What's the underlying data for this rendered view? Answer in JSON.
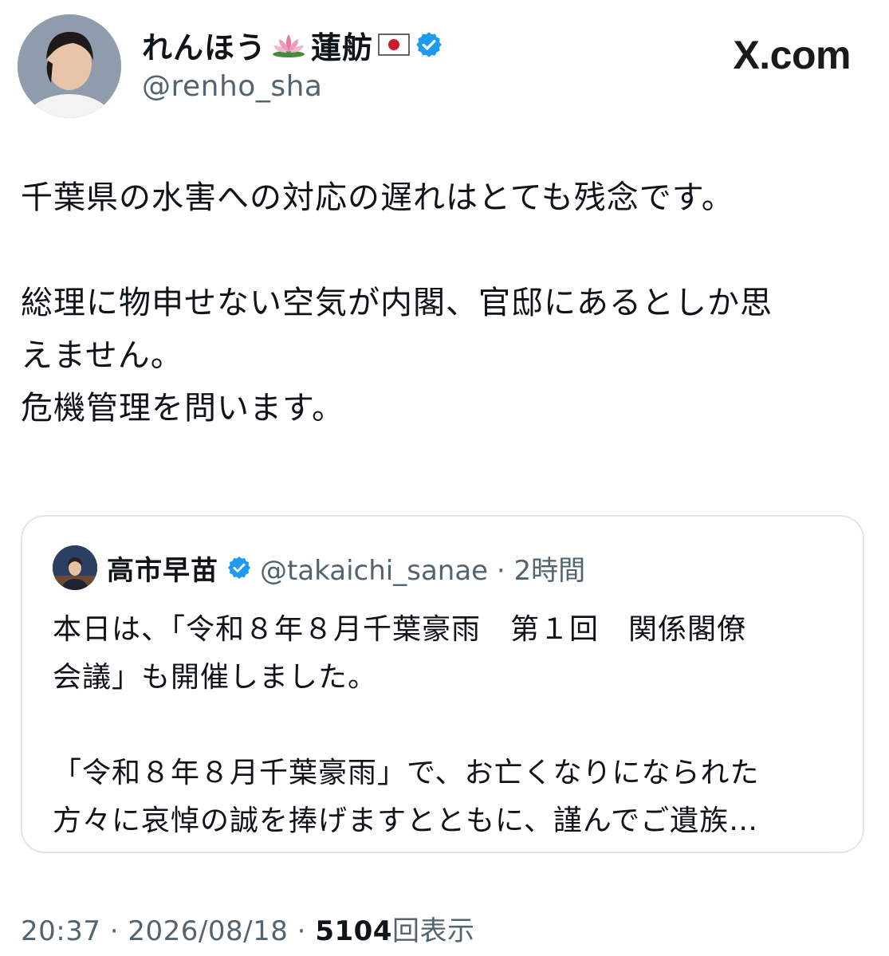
{
  "header": {
    "display_name": "れんほう",
    "display_name_kanji": "蓮舫",
    "handle": "@renho_sha",
    "site_label": "X.com",
    "lotus_icon": "lotus-emoji-icon",
    "flag_icon": "japan-flag-emoji-icon",
    "verified_icon": "verified-badge-icon"
  },
  "tweet": {
    "line1": "千葉県の水害への対応の遅れはとても残念です。",
    "line2": "総理に物申せない空気が内閣、官邸にあるとしか思",
    "line3": "えません。",
    "line4": "危機管理を問います。"
  },
  "quote": {
    "name": "高市早苗",
    "handle_time": "@takaichi_sanae · 2時間",
    "line1": "本日は、「令和８年８月千葉豪雨　第１回　関係閣僚",
    "line2": "会議」も開催しました。",
    "line3": "「令和８年８月千葉豪雨」で、お亡くなりになられた",
    "line4": "方々に哀悼の誠を捧げますとともに、謹んでご遺族…"
  },
  "meta": {
    "time_date": "20:37 · 2026/08/18 ·",
    "views_count": "5104",
    "views_label": "回表示"
  },
  "colors": {
    "verified_blue": "#1d9bf0",
    "secondary_text": "#536471",
    "primary_text": "#0f1419",
    "card_border": "#e1e6ea"
  }
}
